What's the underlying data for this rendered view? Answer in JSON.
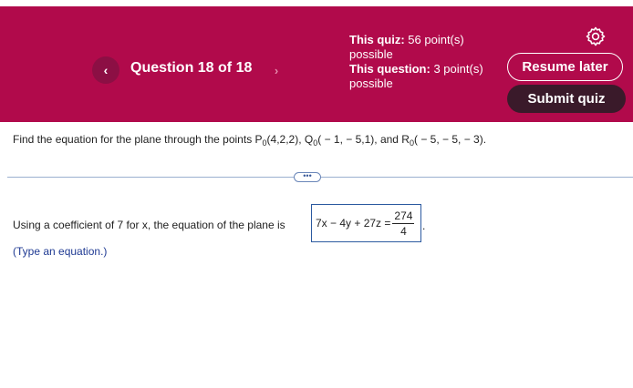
{
  "header": {
    "prev_icon": "‹",
    "question_label": "Question 18 of 18",
    "next_icon": "›",
    "quiz_points_label": "This quiz:",
    "quiz_points_value": "56 point(s) possible",
    "question_points_label": "This question:",
    "question_points_value": "3 point(s) possible",
    "settings_icon": "gear-icon",
    "resume_label": "Resume later",
    "submit_label": "Submit quiz"
  },
  "question": {
    "prefix": "Find the equation for the plane through the points P",
    "p_sub": "0",
    "p_coords": "(4,2,2), Q",
    "q_sub": "0",
    "q_coords": "( − 1, − 5,1), and R",
    "r_sub": "0",
    "r_coords": "( − 5, − 5, − 3)."
  },
  "more_button": "•••",
  "answer": {
    "prompt": "Using a coefficient of 7 for x, the equation of the plane is",
    "equation_lhs": "7x − 4y + 27z =",
    "numerator": "274",
    "denominator": "4",
    "period": "."
  },
  "hint": "(Type an equation.)",
  "colors": {
    "header_bg": "#b10a4b",
    "submit_bg": "#3a1a2a",
    "link_blue": "#1f3a93"
  }
}
